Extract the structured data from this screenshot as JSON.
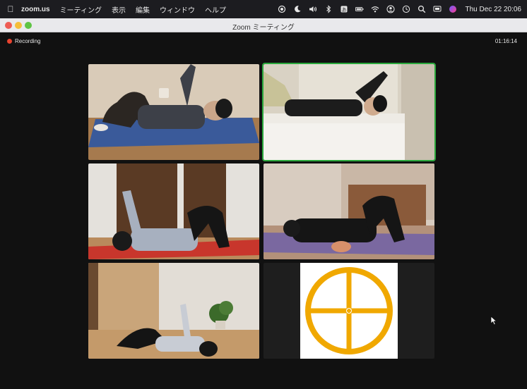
{
  "menubar": {
    "app_name": "zoom.us",
    "menus": [
      "ミーティング",
      "表示",
      "編集",
      "ウィンドウ",
      "ヘルプ"
    ],
    "clock": "Thu Dec 22  20:06"
  },
  "window": {
    "title": "Zoom ミーティング"
  },
  "meeting": {
    "recording_label": "Recording",
    "elapsed_time": "01:16:14"
  },
  "colors": {
    "speaking_border": "#2aa83c",
    "recording_dot": "#e8432f",
    "logo_orange": "#f0a800"
  }
}
